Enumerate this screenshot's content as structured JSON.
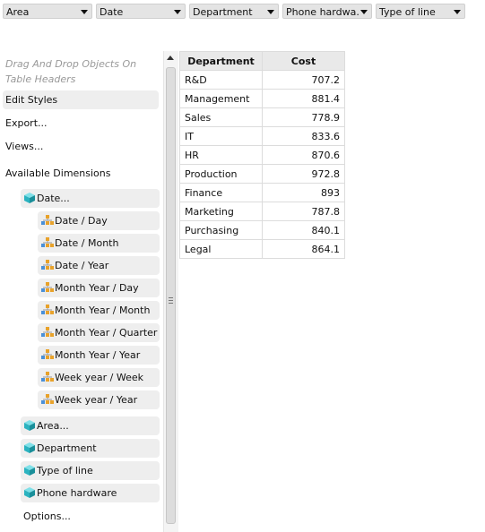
{
  "filters": [
    {
      "label": "Area"
    },
    {
      "label": "Date"
    },
    {
      "label": "Department"
    },
    {
      "label": "Phone hardwa..."
    },
    {
      "label": "Type of line"
    }
  ],
  "panel": {
    "hint": "Drag And Drop Objects On Table Headers",
    "edit_styles": "Edit Styles",
    "export": "Export...",
    "views": "Views...",
    "available_dimensions": "Available Dimensions",
    "date_dimension": "Date...",
    "date_hierarchies": [
      "Date / Day",
      "Date / Month",
      "Date / Year",
      "Month Year / Day",
      "Month Year / Month",
      "Month Year / Quarter",
      "Month Year / Year",
      "Week year / Week",
      "Week year / Year"
    ],
    "other_dimensions": [
      "Area...",
      "Department",
      "Type of line",
      "Phone hardware"
    ],
    "options": "Options..."
  },
  "table": {
    "headers": [
      "Department",
      "Cost"
    ],
    "rows": [
      [
        "R&D",
        "707.2"
      ],
      [
        "Management",
        "881.4"
      ],
      [
        "Sales",
        "778.9"
      ],
      [
        "IT",
        "833.6"
      ],
      [
        "HR",
        "870.6"
      ],
      [
        "Production",
        "972.8"
      ],
      [
        "Finance",
        "893"
      ],
      [
        "Marketing",
        "787.8"
      ],
      [
        "Purchasing",
        "840.1"
      ],
      [
        "Legal",
        "864.1"
      ]
    ]
  },
  "icons": {
    "dimension": "cube-icon",
    "hierarchy": "hierarchy-icon",
    "cube_color": "#2bb3c0",
    "hierarchy_color": "#e8a22a"
  }
}
